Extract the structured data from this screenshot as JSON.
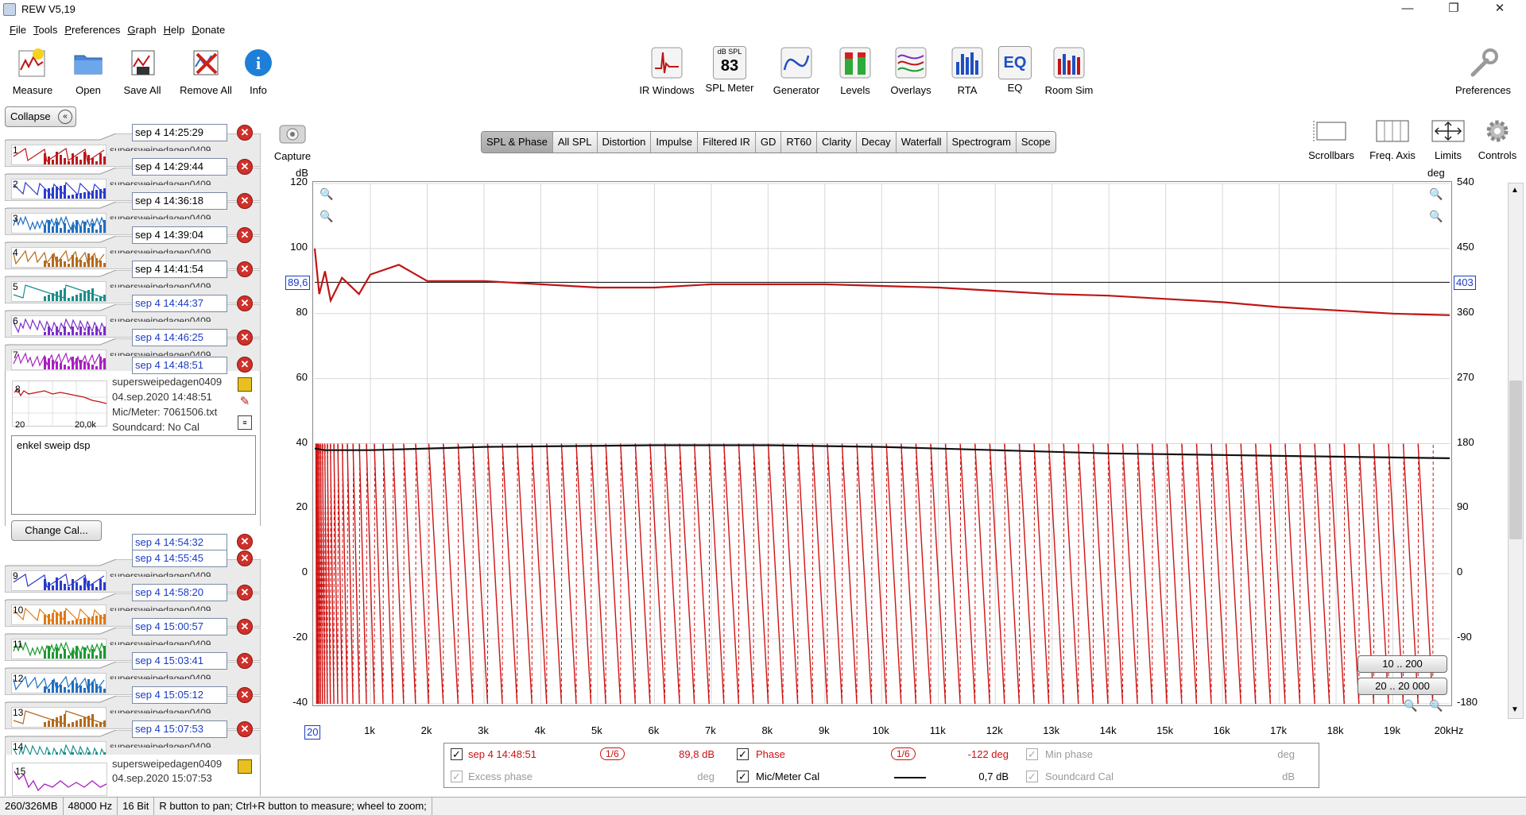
{
  "window": {
    "title": "REW V5,19"
  },
  "menu": [
    {
      "label": "File",
      "u": "F",
      "rest": "ile"
    },
    {
      "label": "Tools",
      "u": "T",
      "rest": "ools"
    },
    {
      "label": "Preferences",
      "u": "P",
      "rest": "references"
    },
    {
      "label": "Graph",
      "u": "G",
      "rest": "raph"
    },
    {
      "label": "Help",
      "u": "H",
      "rest": "elp"
    },
    {
      "label": "Donate",
      "u": "D",
      "rest": "onate"
    }
  ],
  "toolbar_left": [
    "Measure",
    "Open",
    "Save All",
    "Remove All",
    "Info"
  ],
  "toolbar_center": [
    "IR Windows",
    "SPL Meter",
    "Generator",
    "Levels",
    "Overlays",
    "RTA",
    "EQ",
    "Room Sim"
  ],
  "spl_icon": {
    "unit": "dB SPL",
    "value": "83"
  },
  "toolbar_right": "Preferences",
  "left_panel": {
    "collapse_label": "Collapse",
    "measurements": [
      {
        "num": "1",
        "name": "sep 4 14:25:29",
        "color": "#c0171a",
        "blue": false
      },
      {
        "num": "2",
        "name": "sep 4 14:29:44",
        "color": "#2a3bd0",
        "blue": false
      },
      {
        "num": "3",
        "name": "sep 4 14:36:18",
        "color": "#1f6fc2",
        "blue": false
      },
      {
        "num": "4",
        "name": "sep 4 14:39:04",
        "color": "#b46a1c",
        "blue": false
      },
      {
        "num": "5",
        "name": "sep 4 14:41:54",
        "color": "#198f8a",
        "blue": false
      },
      {
        "num": "6",
        "name": "sep 4 14:44:37",
        "color": "#7a2bc9",
        "blue": true
      },
      {
        "num": "7",
        "name": "sep 4 14:46:25",
        "color": "#a81fc0",
        "blue": true
      }
    ],
    "measurements_after": [
      {
        "num": "9",
        "name": "sep 4 14:55:45",
        "color": "#2a3bd0",
        "blue": true
      },
      {
        "num": "10",
        "name": "sep 4 14:58:20",
        "color": "#e07a10",
        "blue": true
      },
      {
        "num": "11",
        "name": "sep 4 15:00:57",
        "color": "#1a9a2e",
        "blue": true
      },
      {
        "num": "12",
        "name": "sep 4 15:03:41",
        "color": "#1f6fc2",
        "blue": true
      },
      {
        "num": "13",
        "name": "sep 4 15:05:12",
        "color": "#b46a1c",
        "blue": true
      },
      {
        "num": "14",
        "name": "sep 4 15:07:53",
        "color": "#198f8a",
        "blue": true
      }
    ],
    "tab_title": "supersweipedagen0409",
    "selected": {
      "num": "8",
      "name": "sep 4 14:48:51",
      "title": "supersweipedagen0409",
      "date": "04.sep.2020 14:48:51",
      "mic": "Mic/Meter: 7061506.txt",
      "soundcard": "Soundcard: No Cal",
      "axis_min": "20",
      "axis_max": "20,0k",
      "note": "enkel sweip dsp"
    },
    "change_cal": "Change Cal...",
    "extra_field": "sep 4 14:54:32",
    "last": {
      "num": "15",
      "title": "supersweipedagen0409",
      "date": "04.sep.2020 15:07:53"
    }
  },
  "capture_label": "Capture",
  "graph_tabs": [
    "SPL & Phase",
    "All SPL",
    "Distortion",
    "Impulse",
    "Filtered IR",
    "GD",
    "RT60",
    "Clarity",
    "Decay",
    "Waterfall",
    "Spectrogram",
    "Scope"
  ],
  "graph_tab_active": "SPL & Phase",
  "graph_tools": [
    "Scrollbars",
    "Freq. Axis",
    "Limits",
    "Controls"
  ],
  "chart_data": {
    "type": "line",
    "ylabel": "dB",
    "y2label": "deg",
    "ylim": [
      -40,
      120
    ],
    "y2lim": [
      -180,
      540
    ],
    "xlim": [
      20,
      20000
    ],
    "yticks": [
      "120",
      "100",
      "80",
      "60",
      "40",
      "20",
      "0",
      "-20",
      "-40"
    ],
    "y2ticks": [
      "540",
      "450",
      "360",
      "270",
      "180",
      "90",
      "0",
      "-90",
      "-180"
    ],
    "xticks": [
      "20",
      "1k",
      "2k",
      "3k",
      "4k",
      "5k",
      "6k",
      "7k",
      "8k",
      "9k",
      "10k",
      "11k",
      "12k",
      "13k",
      "14k",
      "15k",
      "16k",
      "17k",
      "18k",
      "19k",
      "20kHz"
    ],
    "cursor_left": "89,6",
    "cursor_right": "403",
    "cursor_freq": "20",
    "series": [
      {
        "name": "sep 4 14:48:51",
        "color": "#c01515",
        "x": [
          20,
          100,
          200,
          300,
          500,
          800,
          1000,
          1500,
          2000,
          3000,
          4000,
          5000,
          6000,
          7000,
          8000,
          9000,
          10000,
          11000,
          12000,
          13000,
          14000,
          15000,
          16000,
          17000,
          18000,
          19000,
          20000
        ],
        "values": [
          100,
          86,
          93,
          84,
          91,
          86,
          92,
          95,
          90,
          90,
          89,
          88,
          88,
          89,
          89,
          89,
          88.5,
          88,
          87,
          86,
          85.5,
          84.5,
          83.5,
          82,
          81,
          80,
          79.5
        ]
      },
      {
        "name": "Mic/Meter Cal",
        "color": "#111111",
        "x": [
          20,
          200,
          1000,
          3000,
          6000,
          8000,
          10000,
          12000,
          14000,
          16000,
          18000,
          20000
        ],
        "values": [
          38.5,
          38,
          38,
          39,
          39.5,
          39.5,
          39,
          38,
          37,
          36.5,
          36,
          35.5
        ]
      },
      {
        "name": "Phase",
        "color": "#d01212",
        "x": [
          20,
          20000
        ],
        "values": [
          180,
          -180
        ]
      }
    ]
  },
  "range_buttons": [
    "10 .. 200",
    "20 .. 20 000"
  ],
  "legend": {
    "row1": [
      {
        "label": "sep 4 14:48:51",
        "smooth": "1/6",
        "value": "89,8 dB",
        "checked": true,
        "style": "red"
      },
      {
        "label": "Phase",
        "smooth": "1/6",
        "value": "-122 deg",
        "checked": true,
        "style": "red"
      },
      {
        "label": "Min phase",
        "value": "deg",
        "checked": true,
        "style": "gray"
      }
    ],
    "row2": [
      {
        "label": "Excess phase",
        "value": "deg",
        "checked": true,
        "style": "gray"
      },
      {
        "label": "Mic/Meter Cal",
        "value": "0,7 dB",
        "checked": true,
        "style": "black"
      },
      {
        "label": "Soundcard Cal",
        "value": "dB",
        "checked": true,
        "style": "gray"
      }
    ]
  },
  "status": [
    "260/326MB",
    "48000 Hz",
    "16 Bit",
    "R button to pan; Ctrl+R button to measure; wheel to zoom;"
  ]
}
